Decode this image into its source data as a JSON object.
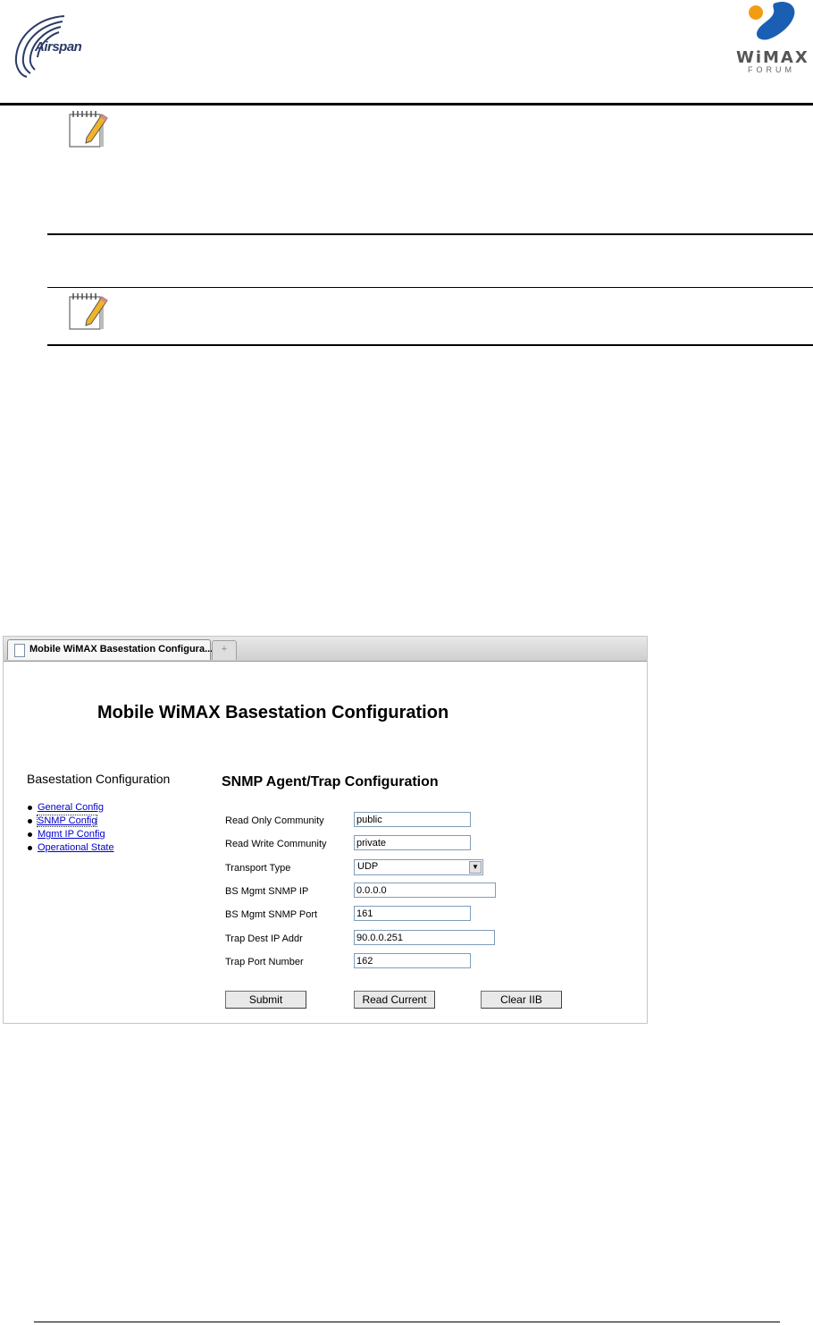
{
  "header": {
    "left_logo_text": "Airspan",
    "right_logo_text": "WiMAX",
    "right_logo_subtext": "FORUM"
  },
  "notes": [
    {
      "icon": "notepad-pencil-icon"
    },
    {
      "icon": "notepad-pencil-icon"
    }
  ],
  "browser": {
    "tab_label": "Mobile WiMAX Basestation Configura...",
    "page_title": "Mobile WiMAX Basestation Configuration",
    "sidebar": {
      "heading": "Basestation Configuration",
      "items": [
        {
          "label": "General Config"
        },
        {
          "label": "SNMP Config",
          "active": true
        },
        {
          "label": "Mgmt IP Config"
        },
        {
          "label": "Operational State"
        }
      ]
    },
    "form": {
      "heading": "SNMP Agent/Trap Configuration",
      "fields": [
        {
          "label": "Read Only Community",
          "value": "public"
        },
        {
          "label": "Read Write Community",
          "value": "private"
        },
        {
          "label": "Transport Type",
          "value": "UDP"
        },
        {
          "label": "BS Mgmt SNMP IP",
          "value": "0.0.0.0"
        },
        {
          "label": "BS Mgmt SNMP Port",
          "value": "161"
        },
        {
          "label": "Trap Dest IP Addr",
          "value": "90.0.0.251"
        },
        {
          "label": "Trap Port Number",
          "value": "162"
        }
      ],
      "buttons": {
        "submit": "Submit",
        "read_current": "Read Current",
        "clear_iib": "Clear IIB"
      }
    }
  }
}
